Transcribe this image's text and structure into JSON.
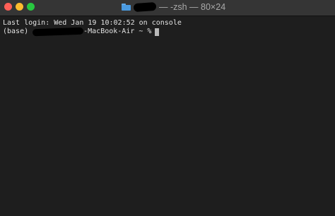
{
  "window": {
    "title_suffix": "— -zsh — 80×24",
    "folder_icon": "folder-icon"
  },
  "terminal": {
    "last_login": "Last login: Wed Jan 19 10:02:52 on console",
    "prompt_prefix": "(base)",
    "prompt_suffix": "-MacBook-Air ~ %"
  },
  "colors": {
    "close": "#ff5f57",
    "minimize": "#febc2e",
    "maximize": "#28c840",
    "background": "#1e1e1e",
    "text": "#e2e2e2"
  }
}
